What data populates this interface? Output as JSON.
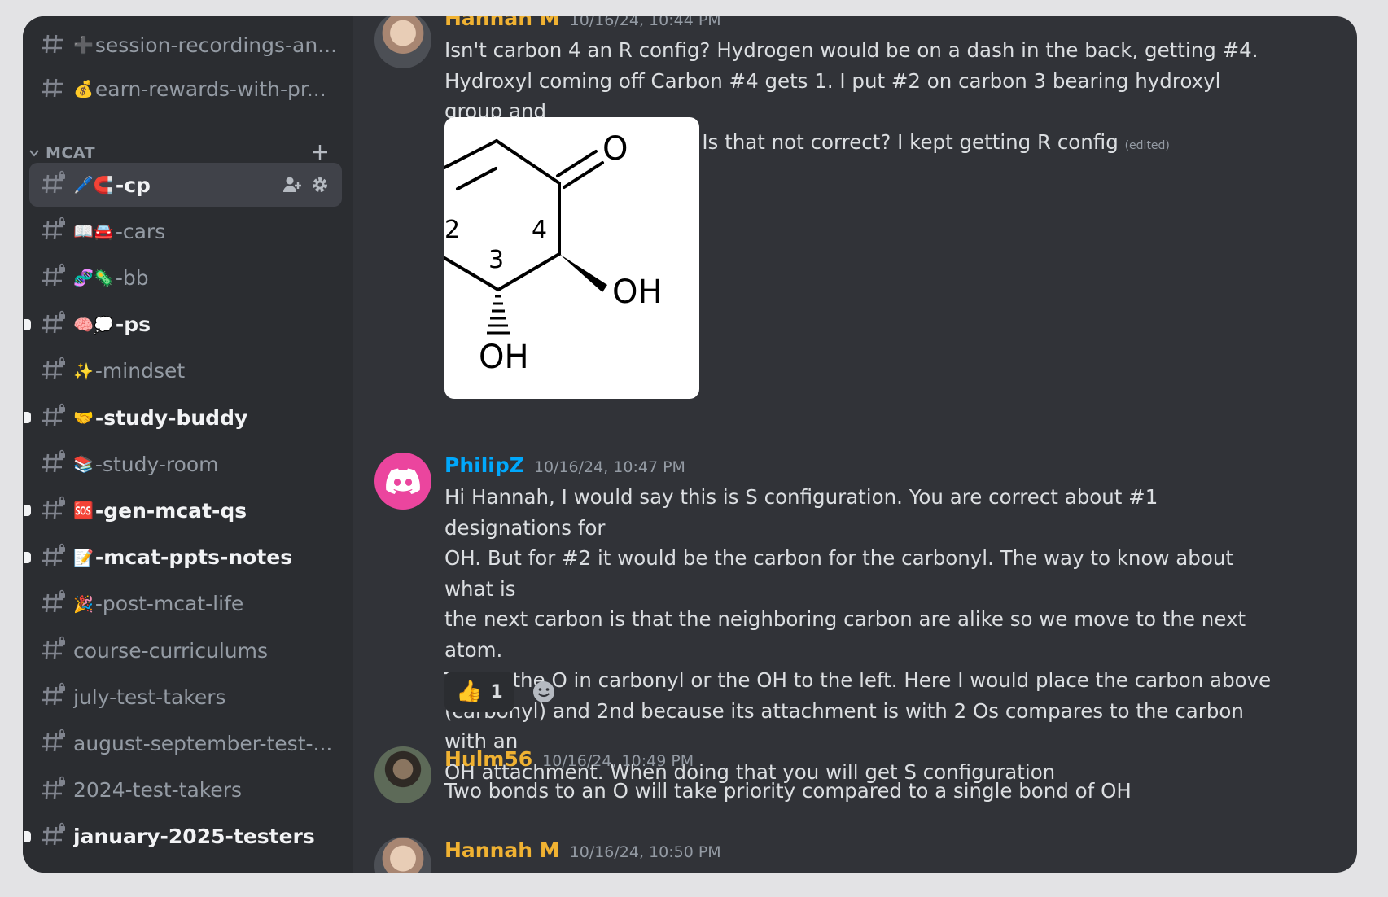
{
  "sidebar": {
    "channels_top": [
      {
        "emoji": "➕",
        "name": "session-recordings-an..."
      },
      {
        "emoji": "💰",
        "name": "earn-rewards-with-pr..."
      }
    ],
    "category": {
      "name": "MCAT"
    },
    "channels": [
      {
        "emoji": "🖊️🧲",
        "name": "-cp",
        "state": "selected"
      },
      {
        "emoji": "📖🚘",
        "name": "-cars",
        "state": "read"
      },
      {
        "emoji": "🧬🦠",
        "name": "-bb",
        "state": "read"
      },
      {
        "emoji": "🧠💭",
        "name": "-ps",
        "state": "unread"
      },
      {
        "emoji": "✨",
        "name": "-mindset",
        "state": "read"
      },
      {
        "emoji": "🤝",
        "name": "-study-buddy",
        "state": "unread"
      },
      {
        "emoji": "📚",
        "name": "-study-room",
        "state": "read"
      },
      {
        "emoji": "🆘",
        "name": "-gen-mcat-qs",
        "state": "unread"
      },
      {
        "emoji": "📝",
        "name": "-mcat-ppts-notes",
        "state": "unread"
      },
      {
        "emoji": "🎉",
        "name": "-post-mcat-life",
        "state": "read"
      },
      {
        "emoji": "",
        "name": "course-curriculums",
        "state": "read"
      },
      {
        "emoji": "",
        "name": "july-test-takers",
        "state": "read"
      },
      {
        "emoji": "",
        "name": "august-september-test-...",
        "state": "read"
      },
      {
        "emoji": "",
        "name": "2024-test-takers",
        "state": "read"
      },
      {
        "emoji": "",
        "name": "january-2025-testers",
        "state": "unread"
      }
    ]
  },
  "messages": [
    {
      "author": "Hannah M",
      "author_color": "#f0b232",
      "timestamp": "10/16/24, 10:44 PM",
      "lines": [
        "Isn't carbon 4 an R config? Hydrogen would be on a dash in the back, getting #4.",
        "Hydroxyl coming off Carbon #4 gets 1. I put #2 on carbon 3 bearing hydroxyl group and",
        "carbon 4 bearing ketone. Is that not correct? I kept getting R config"
      ],
      "edited": "(edited)",
      "image_labels": {
        "o_top": "O",
        "oh_right": "OH",
        "oh_bottom": "OH",
        "n2": "2",
        "n3": "3",
        "n4": "4"
      }
    },
    {
      "author": "PhilipZ",
      "author_color": "#00a8fc",
      "timestamp": "10/16/24, 10:47 PM",
      "lines": [
        "Hi Hannah, I would say this is S configuration. You are correct about #1 designations for",
        "OH. But for #2 it would be the carbon for the carbonyl. The way to know about what is",
        "the next carbon is that the neighboring carbon are alike so we move to the next atom.",
        "That’s the O in carbonyl or the OH to the left. Here I would place the carbon above",
        "(carbonyl) and 2nd because its attachment is with 2 Os compares to the carbon with an",
        "OH attachment. When doing that you will get S configuration"
      ],
      "reaction": {
        "emoji": "👍",
        "count": "1"
      }
    },
    {
      "author": "Hulm56",
      "author_color": "#f0b232",
      "timestamp": "10/16/24, 10:49 PM",
      "lines": [
        "Two bonds to an O will take priority compared to a single bond of OH"
      ]
    },
    {
      "author": "Hannah M",
      "author_color": "#f0b232",
      "timestamp": "10/16/24, 10:50 PM",
      "lines": []
    }
  ],
  "colors": {
    "sidebar_bg": "#2b2d31",
    "chat_bg": "#313338",
    "selected_bg": "#404249",
    "discord_pink": "#eb459e"
  }
}
